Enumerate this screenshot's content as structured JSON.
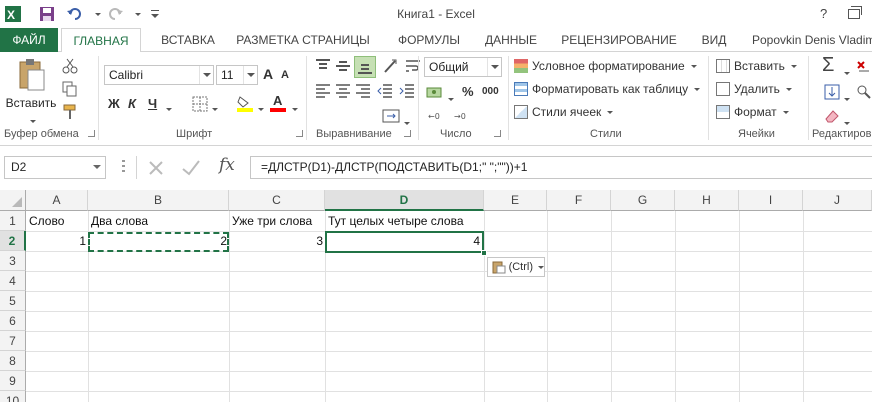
{
  "window": {
    "title": "Книга1 - Excel",
    "help": "?"
  },
  "ribbon_tabs": [
    "ФАЙЛ",
    "ГЛАВНАЯ",
    "ВСТАВКА",
    "РАЗМЕТКА СТРАНИЦЫ",
    "ФОРМУЛЫ",
    "ДАННЫЕ",
    "РЕЦЕНЗИРОВАНИЕ",
    "ВИД"
  ],
  "user": "Popovkin Denis Vladim",
  "clipboard": {
    "paste_label": "Вставить",
    "group_label": "Буфер обмена"
  },
  "font": {
    "name": "Calibri",
    "size": "11",
    "bold": "Ж",
    "italic": "К",
    "underline": "Ч",
    "grow": "A",
    "shrink": "A",
    "font_color_glyph": "A",
    "group_label": "Шрифт"
  },
  "alignment": {
    "group_label": "Выравнивание"
  },
  "number": {
    "format": "Общий",
    "percent": "%",
    "thousands": "000",
    "group_label": "Число"
  },
  "styles": {
    "conditional": "Условное форматирование",
    "as_table": "Форматировать как таблицу",
    "cell_styles": "Стили ячеек",
    "group_label": "Стили"
  },
  "cells": {
    "insert": "Вставить",
    "delete": "Удалить",
    "format": "Формат",
    "group_label": "Ячейки"
  },
  "editing": {
    "sigma": "Σ",
    "group_label": "Редактиров"
  },
  "formula_bar": {
    "name_box": "D2",
    "fx": "fx",
    "formula": "=ДЛСТР(D1)-ДЛСТР(ПОДСТАВИТЬ(D1;\" \";\"\"))+1"
  },
  "columns": [
    "A",
    "B",
    "C",
    "D",
    "E",
    "F",
    "G",
    "H",
    "I",
    "J"
  ],
  "rows": [
    "1",
    "2",
    "3",
    "4",
    "5",
    "6",
    "7",
    "8",
    "9",
    "10"
  ],
  "sheet": {
    "A1": "Слово",
    "B1": "Два слова",
    "C1": "Уже три слова",
    "D1": "Тут целых четыре слова",
    "A2": "1",
    "B2": "2",
    "C2": "3",
    "D2": "4"
  },
  "paste_options_label": "(Ctrl)",
  "colors": {
    "accent": "#217346"
  }
}
